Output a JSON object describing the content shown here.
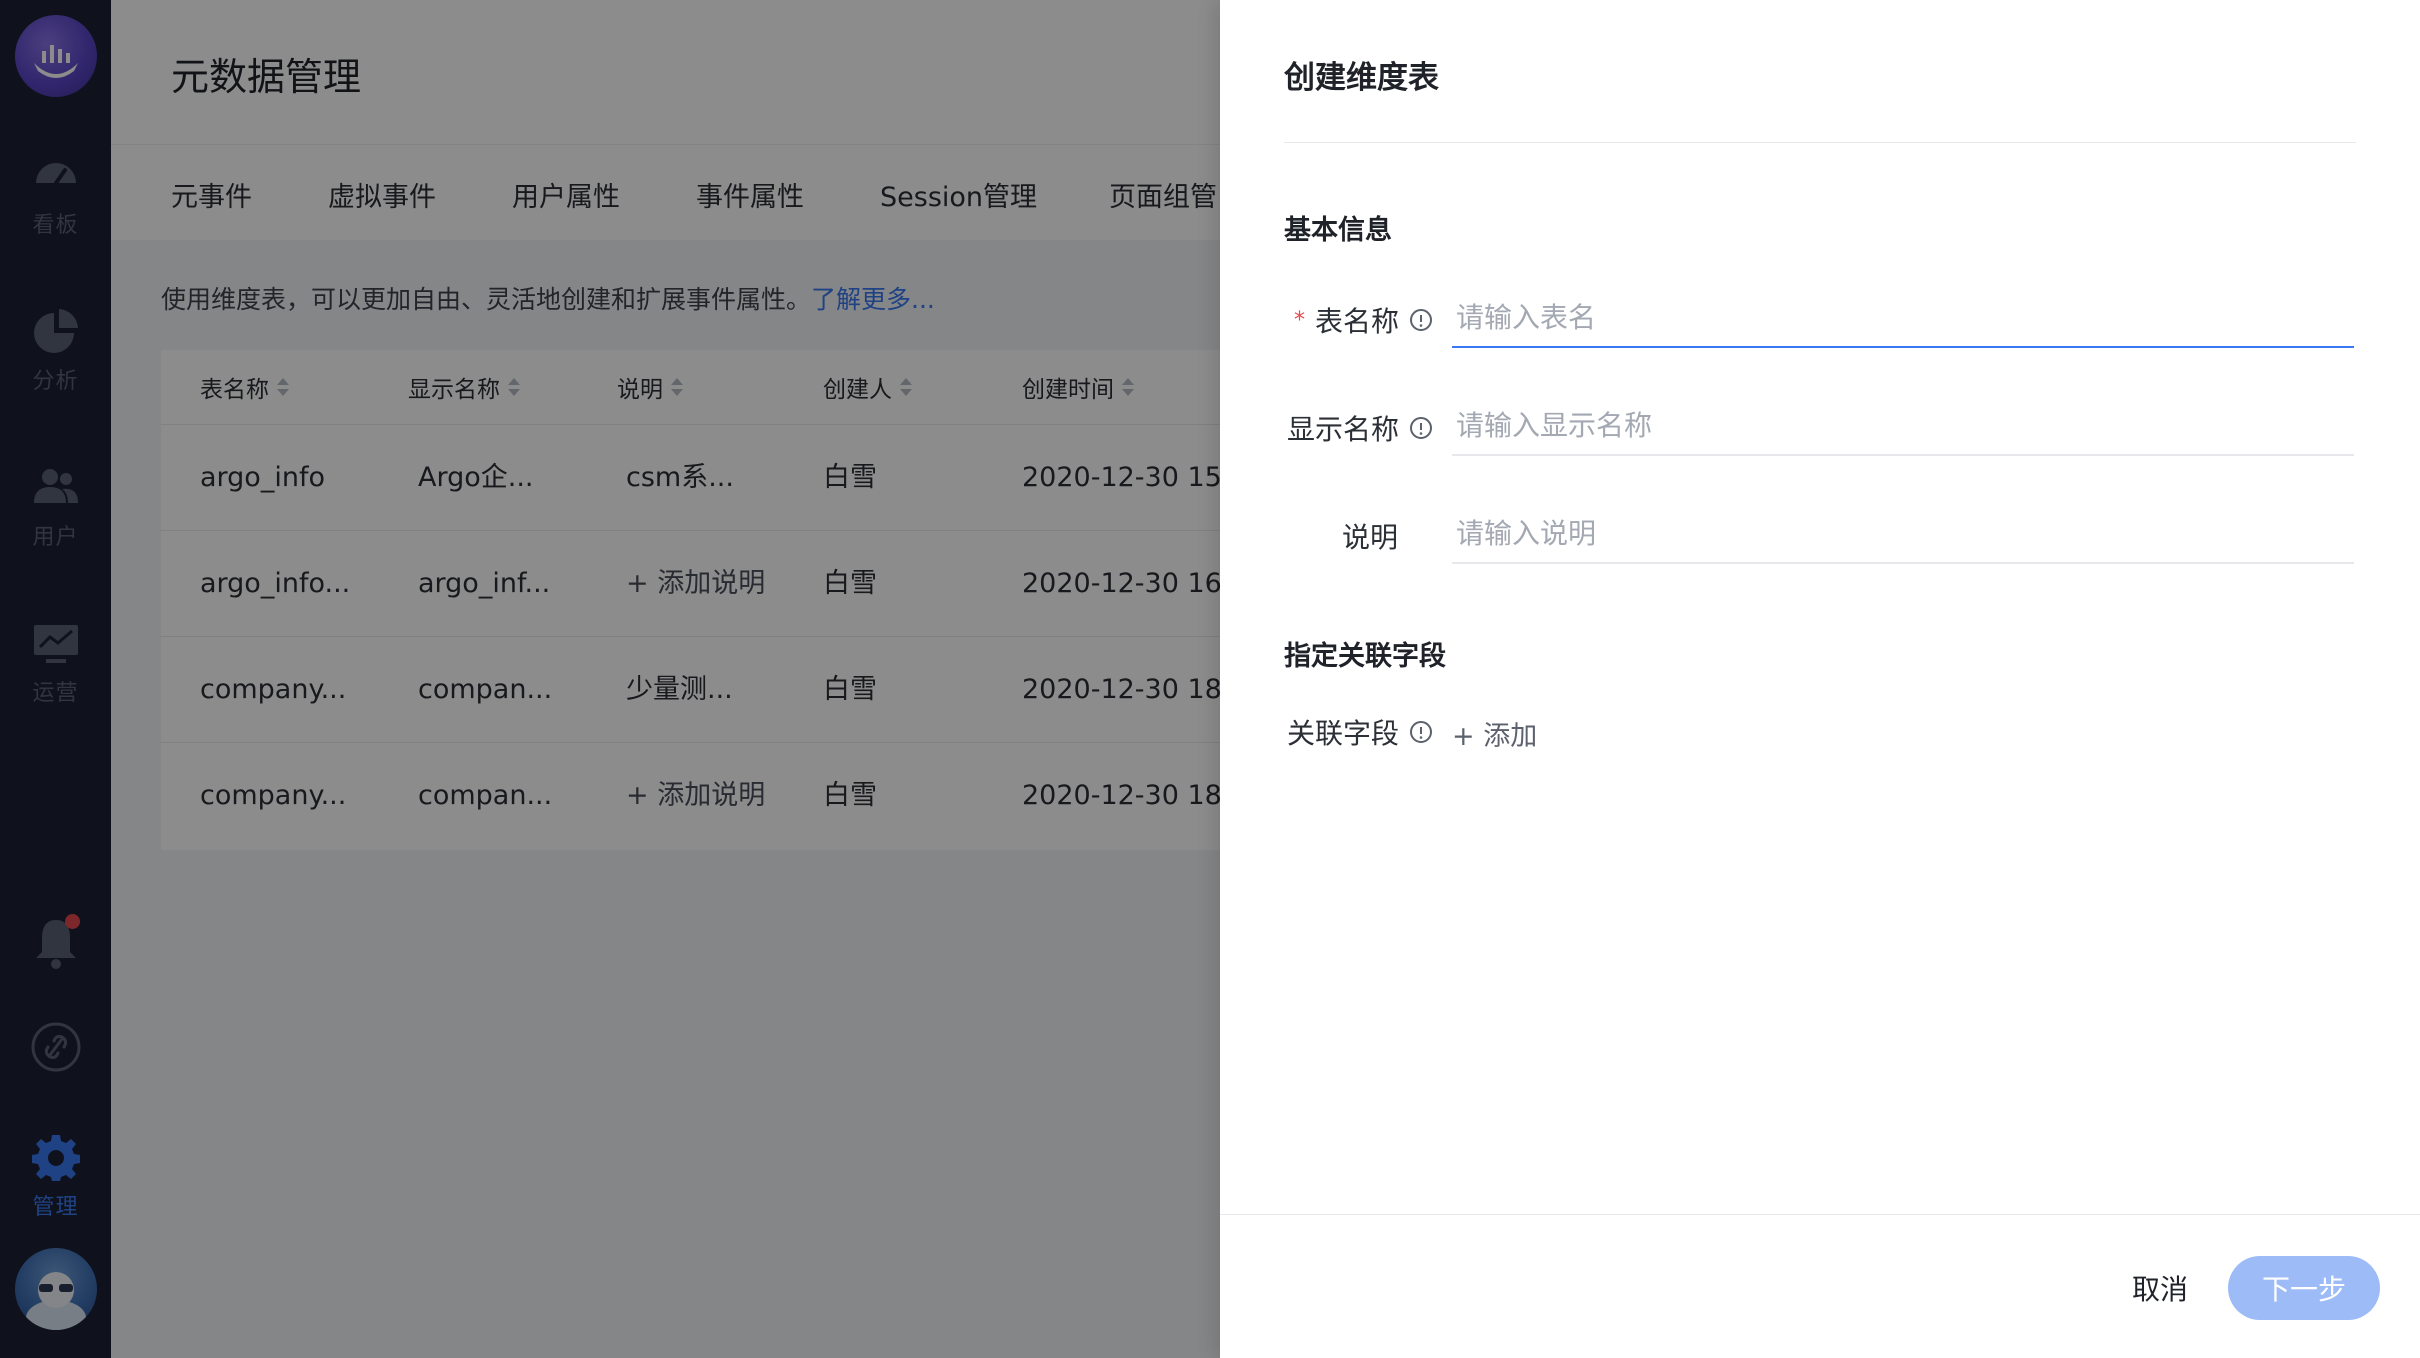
{
  "nav": {
    "items": [
      {
        "label": "看板",
        "icon": "dashboard-icon"
      },
      {
        "label": "分析",
        "icon": "pie-chart-icon"
      },
      {
        "label": "用户",
        "icon": "users-icon"
      },
      {
        "label": "运营",
        "icon": "monitor-chart-icon"
      },
      {
        "label": "管理",
        "icon": "gear-icon",
        "active": true
      }
    ],
    "bell_icon": "bell-icon",
    "link_icon": "link-icon",
    "accent": "#3a78f2"
  },
  "page": {
    "title": "元数据管理",
    "tabs": [
      "元事件",
      "虚拟事件",
      "用户属性",
      "事件属性",
      "Session管理",
      "页面组管"
    ],
    "description": "使用维度表，可以更加自由、灵活地创建和扩展事件属性。",
    "learn_more": "了解更多..."
  },
  "table": {
    "headers": [
      "表名称",
      "显示名称",
      "说明",
      "创建人",
      "创建时间"
    ],
    "rows": [
      [
        "argo_info",
        "Argo企...",
        "csm系...",
        "白雪",
        "2020-12-30 15"
      ],
      [
        "argo_info...",
        "argo_inf...",
        "+ 添加说明",
        "白雪",
        "2020-12-30 16"
      ],
      [
        "company...",
        "compan...",
        "少量测...",
        "白雪",
        "2020-12-30 18"
      ],
      [
        "company...",
        "compan...",
        "+ 添加说明",
        "白雪",
        "2020-12-30 18"
      ]
    ]
  },
  "drawer": {
    "title": "创建维度表",
    "basic_section": "基本信息",
    "table_name_label": "表名称",
    "table_name_placeholder": "请输入表名",
    "display_name_label": "显示名称",
    "display_name_placeholder": "请输入显示名称",
    "desc_label": "说明",
    "desc_placeholder": "请输入说明",
    "assoc_section": "指定关联字段",
    "assoc_label": "关联字段",
    "add_label": "+ 添加",
    "cancel_label": "取消",
    "next_label": "下一步",
    "required_mark": "*"
  }
}
